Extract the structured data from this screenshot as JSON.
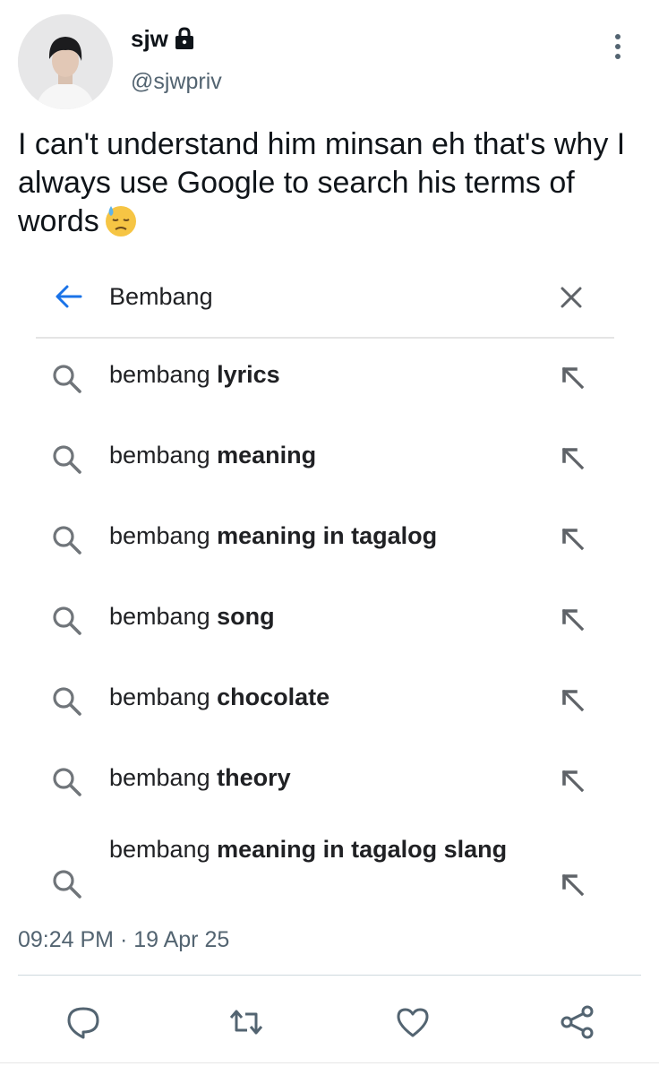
{
  "author": {
    "display_name": "sjw",
    "handle": "@sjwpriv",
    "protected_icon": "lock-icon",
    "avatar": "avatar"
  },
  "tweet": {
    "text": "I can't understand him minsan eh that's why I always use Google to  search his terms of words",
    "emoji": "downcast-face-with-sweat-icon",
    "timestamp": "09:24 PM · 19 Apr 25"
  },
  "search": {
    "query": "Bembang",
    "back_icon": "back-arrow-icon",
    "clear_icon": "close-icon",
    "suggestions": [
      {
        "prefix": "bembang",
        "bold": "lyrics"
      },
      {
        "prefix": "bembang",
        "bold": "meaning"
      },
      {
        "prefix": "bembang",
        "bold": "meaning in tagalog"
      },
      {
        "prefix": "bembang",
        "bold": "song"
      },
      {
        "prefix": "bembang",
        "bold": "chocolate"
      },
      {
        "prefix": "bembang",
        "bold": "theory"
      },
      {
        "prefix": "bembang",
        "bold": "meaning in tagalog slang"
      }
    ]
  },
  "actions": [
    "reply-icon",
    "retweet-icon",
    "like-icon",
    "share-icon"
  ],
  "colors": {
    "accent": "#1a73e8",
    "secondary_text": "#536471",
    "icon_gray": "#70757a"
  }
}
